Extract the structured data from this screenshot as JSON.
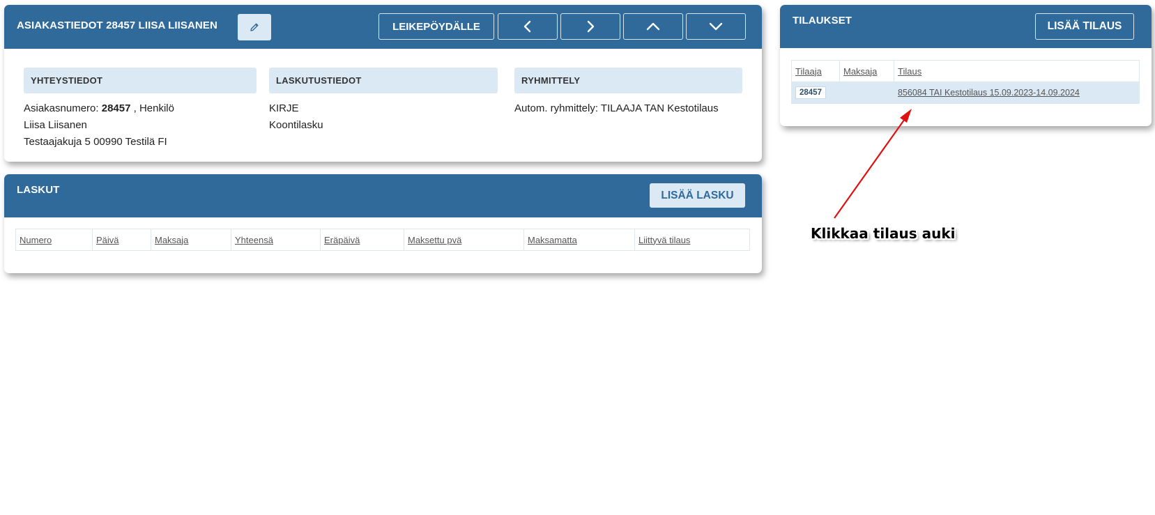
{
  "customer": {
    "title": "ASIAKASTIEDOT 28457 LIISA LIISANEN",
    "edit_icon": "pencil-icon",
    "clipboard_label": "LEIKEPÖYDÄLLE",
    "nav_icons": [
      "chevron-left-icon",
      "chevron-right-icon",
      "chevron-up-icon",
      "chevron-down-icon"
    ],
    "contact": {
      "heading": "YHTEYSTIEDOT",
      "number_label": "Asiakasnumero:",
      "number_value": "28457",
      "type_suffix": ", Henkilö",
      "name": "Liisa Liisanen",
      "address": "Testaajakuja 5 00990 Testilä FI"
    },
    "billing": {
      "heading": "LASKUTUSTIEDOT",
      "line1": "KIRJE",
      "line2": "Koontilasku"
    },
    "grouping": {
      "heading": "RYHMITTELY",
      "line1": "Autom. ryhmittely: TILAAJA TAN Kestotilaus"
    }
  },
  "invoices": {
    "title": "LASKUT",
    "add_label": "LISÄÄ LASKU",
    "columns": [
      "Numero",
      "Päivä",
      "Maksaja",
      "Yhteensä",
      "Eräpäivä",
      "Maksettu pvä",
      "Maksamatta",
      "Liittyvä tilaus"
    ]
  },
  "orders": {
    "title": "TILAUKSET",
    "add_label": "LISÄÄ TILAUS",
    "columns": [
      "Tilaaja",
      "Maksaja",
      "Tilaus"
    ],
    "rows": [
      {
        "orderer": "28457",
        "payer": "",
        "order": "856084 TAI Kestotilaus 15.09.2023-14.09.2024"
      }
    ]
  },
  "annotation": {
    "text": "Klikkaa tilaus auki",
    "color": "#e01010"
  },
  "colors": {
    "header_blue": "#2f6a9b",
    "light_blue": "#dbe9f5"
  }
}
